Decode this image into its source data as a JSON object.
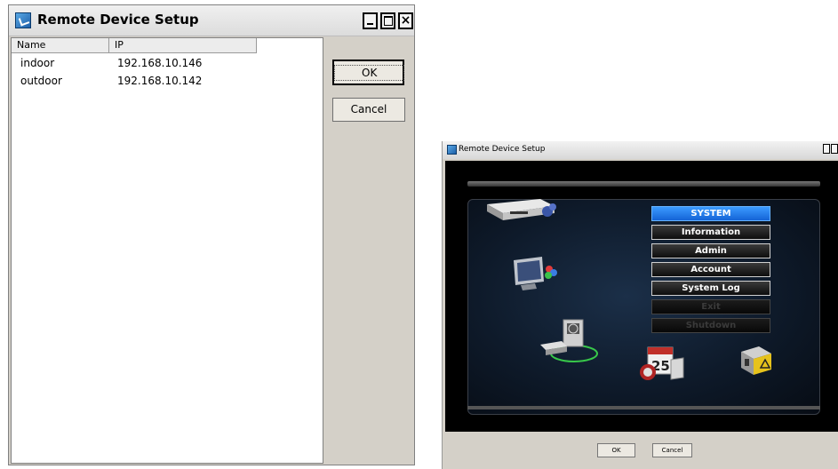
{
  "left_dialog": {
    "title": "Remote Device Setup",
    "columns": [
      "Name",
      "IP"
    ],
    "rows": [
      {
        "name": "indoor",
        "ip": "192.168.10.146"
      },
      {
        "name": "outdoor",
        "ip": "192.168.10.142"
      }
    ],
    "ok_label": "OK",
    "cancel_label": "Cancel"
  },
  "right_dialog": {
    "title": "Remote Device Setup",
    "menu": [
      {
        "label": "SYSTEM",
        "state": "active"
      },
      {
        "label": "Information",
        "state": "normal"
      },
      {
        "label": "Admin",
        "state": "normal"
      },
      {
        "label": "Account",
        "state": "normal"
      },
      {
        "label": "System Log",
        "state": "normal"
      },
      {
        "label": "Exit",
        "state": "disabled"
      },
      {
        "label": "Shutdown",
        "state": "disabled"
      }
    ],
    "calendar_day": "25",
    "ok_label": "OK",
    "cancel_label": "Cancel"
  }
}
